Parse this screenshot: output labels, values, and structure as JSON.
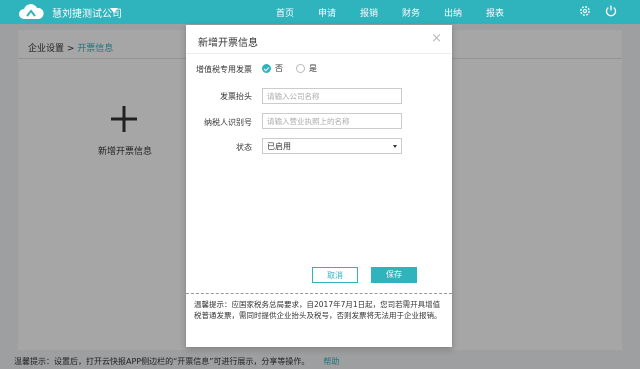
{
  "header": {
    "company": "慧刘捷测试公司",
    "nav": [
      "首页",
      "申请",
      "报销",
      "财务",
      "出纳",
      "报表"
    ]
  },
  "breadcrumb": {
    "parent": "企业设置 >",
    "current": "开票信息"
  },
  "add_card": {
    "label": "新增开票信息"
  },
  "modal": {
    "title": "新增开票信息",
    "close": "×",
    "vat_label": "增值税专用发票",
    "vat_options": [
      {
        "label": "否",
        "selected": true
      },
      {
        "label": "是",
        "selected": false
      }
    ],
    "title_label": "发票抬头",
    "title_placeholder": "请输入公司名称",
    "taxid_label": "纳税人识别号",
    "taxid_placeholder": "请输入营业执照上的名称",
    "status_label": "状态",
    "status_value": "已启用",
    "cancel_label": "取消",
    "save_label": "保存",
    "tip": "温馨提示：应国家税务总局要求，自2017年7月1日起，您司若需开具增值税普通发票，需同时提供企业抬头及税号，否则发票将无法用于企业报销。"
  },
  "bottom_tip": {
    "text": "温馨提示：设置后，打开云快报APP侧边栏的“开票信息”可进行展示，分享等操作。",
    "link": "帮助"
  },
  "colors": {
    "accent": "#2fb3bd",
    "overlay": "rgba(0,0,0,0.35)"
  }
}
